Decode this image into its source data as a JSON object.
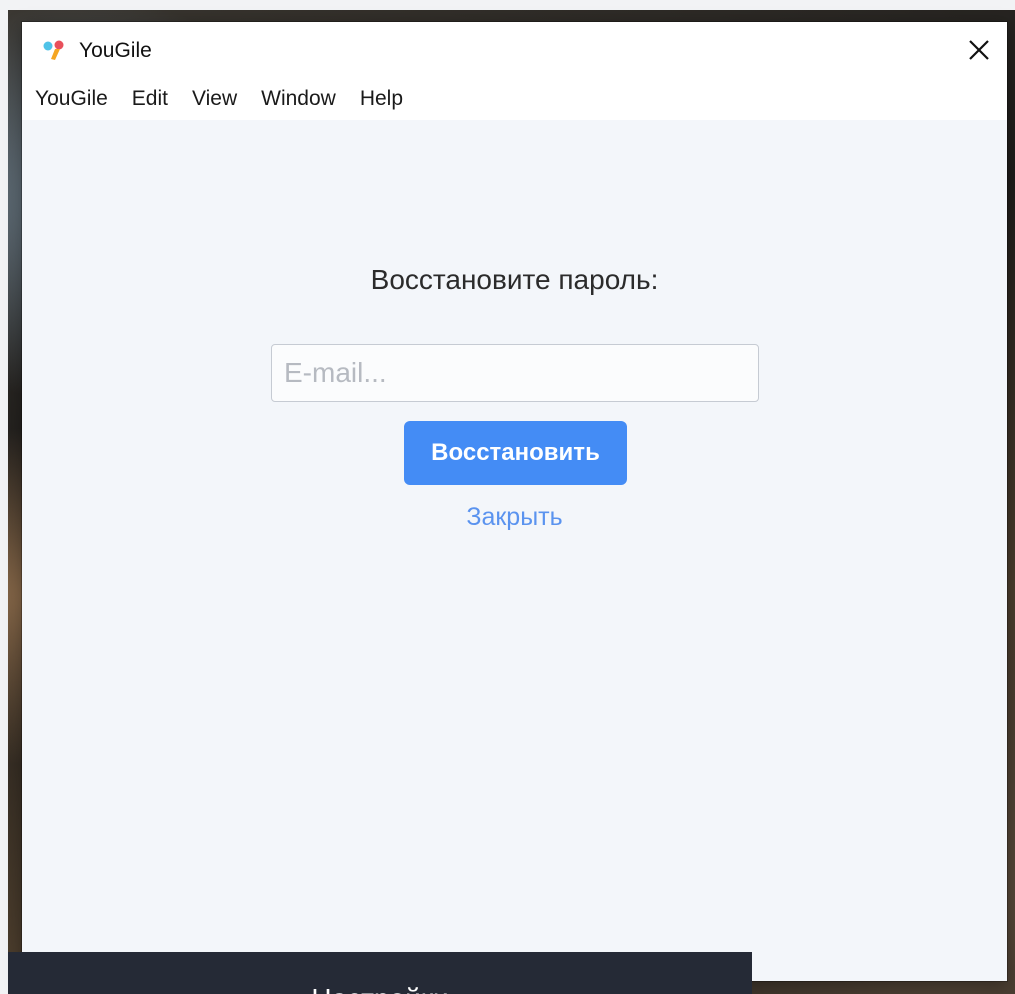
{
  "window": {
    "title": "YouGile",
    "close_icon": "close-icon",
    "logo_icon": "yougile-logo-icon"
  },
  "menubar": {
    "items": [
      {
        "label": "YouGile"
      },
      {
        "label": "Edit"
      },
      {
        "label": "View"
      },
      {
        "label": "Window"
      },
      {
        "label": "Help"
      }
    ]
  },
  "form": {
    "heading": "Восстановите пароль:",
    "email_placeholder": "E-mail...",
    "email_value": "",
    "submit_label": "Восстановить",
    "close_label": "Закрыть"
  },
  "background_window": {
    "title": "Настройки"
  },
  "colors": {
    "accent": "#448cf5",
    "link": "#5a93ef",
    "content_bg": "#f3f6fa",
    "dark_panel": "#252a36"
  }
}
